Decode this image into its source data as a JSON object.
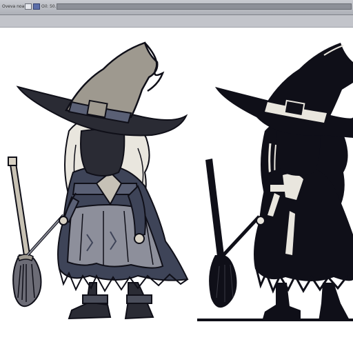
{
  "toolbar": {
    "label": "Oveva noa",
    "label2": "Oil: 50...",
    "active_tool": "select"
  },
  "canvas": {
    "variants": [
      "color-illustration",
      "silhouette"
    ],
    "colors": {
      "ink": "#0f0f18",
      "hat": "#9e998f",
      "dress": "#3e4458",
      "skirt": "#8d8f9b",
      "broom": "#c8c2b4"
    }
  }
}
